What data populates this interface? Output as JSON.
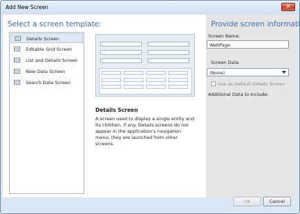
{
  "window": {
    "title": "Add New Screen",
    "close_glyph": "✕"
  },
  "left": {
    "heading": "Select a screen template:",
    "templates": [
      {
        "label": "Details Screen",
        "selected": true
      },
      {
        "label": "Editable Grid Screen"
      },
      {
        "label": "List and Details Screen"
      },
      {
        "label": "New Data Screen"
      },
      {
        "label": "Search Data Screen"
      }
    ],
    "description_title": "Details Screen",
    "description_text": "A screen used to display a single entity and its children, if any.  Details screens do not appear in the application's navigation menu; they are launched from other screens."
  },
  "right": {
    "heading": "Provide screen information:",
    "screen_name_label": "Screen Name:",
    "screen_name_value": "WebPage",
    "screen_data_label": "Screen Data",
    "screen_data_value": "(None)",
    "default_details_label": "Use as Default Details Screen",
    "additional_label": "Additional Data to Include:"
  },
  "buttons": {
    "ok": "OK",
    "cancel": "Cancel"
  },
  "colors": {
    "heading": "#3c6bb0",
    "right_panel": "#e6e6e6"
  }
}
